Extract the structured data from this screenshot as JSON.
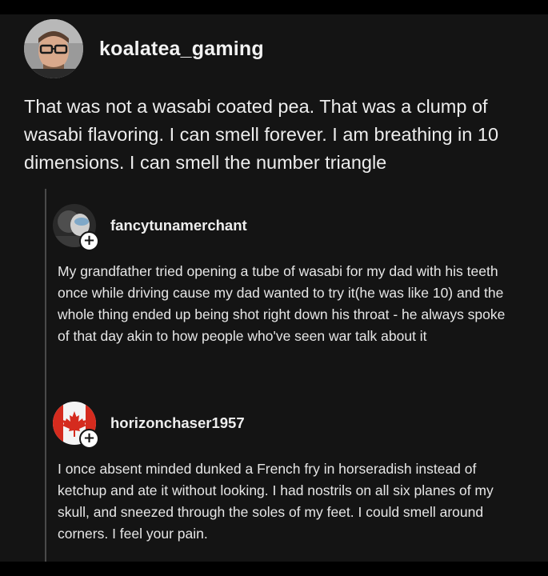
{
  "post": {
    "username": "koalatea_gaming",
    "avatar_icon": "user-avatar-icon",
    "text": "That was not a wasabi coated pea. That was a clump of wasabi flavoring. I can smell forever. I am breathing in 10 dimensions. I can smell the number triangle"
  },
  "replies": [
    {
      "username": "fancytunamerchant",
      "avatar_icon": "user-avatar-icon",
      "badge": "+",
      "text": "My grandfather tried opening a tube of wasabi for my dad with his teeth once while driving cause my dad wanted to try it(he was like 10) and the whole thing ended up being shot right down his throat - he always spoke of that day akin to how people who've seen war talk about it"
    },
    {
      "username": "horizonchaser1957",
      "avatar_icon": "canada-flag-icon",
      "badge": "+",
      "text": "I once absent minded dunked a French fry in horseradish instead of ketchup and ate it without looking. I had nostrils on all six planes of my skull, and sneezed through the soles of my feet. I could smell around corners. I feel your pain."
    }
  ],
  "colors": {
    "background": "#141414",
    "text": "#ececec",
    "thread_line": "#4a4a4a",
    "flag_red": "#d52b1e"
  }
}
